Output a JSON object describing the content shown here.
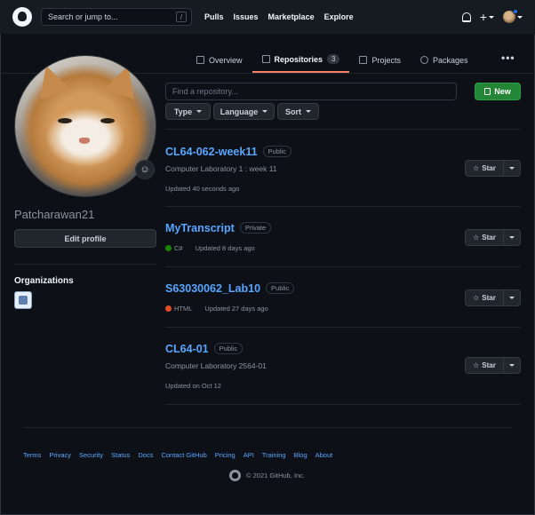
{
  "header": {
    "search_placeholder": "Search or jump to...",
    "search_key": "/",
    "nav": [
      "Pulls",
      "Issues",
      "Marketplace",
      "Explore"
    ],
    "plus": "+"
  },
  "tabs": [
    {
      "label": "Overview",
      "icon": "book-open-icon"
    },
    {
      "label": "Repositories",
      "icon": "repo-icon",
      "count": "3",
      "active": true
    },
    {
      "label": "Projects",
      "icon": "project-icon"
    },
    {
      "label": "Packages",
      "icon": "package-icon"
    }
  ],
  "more": "•••",
  "profile": {
    "username": "Patcharawan21",
    "edit_label": "Edit profile",
    "organizations_title": "Organizations",
    "emoji": "☺"
  },
  "filters": {
    "find_placeholder": "Find a repository...",
    "new_label": "New",
    "type_label": "Type",
    "language_label": "Language",
    "sort_label": "Sort"
  },
  "repos": [
    {
      "name": "CL64-062-week11",
      "visibility": "Public",
      "description": "Computer Laboratory 1 : week 11",
      "language": "",
      "updated": "Updated 40 seconds ago"
    },
    {
      "name": "MyTranscript",
      "visibility": "Private",
      "description": "",
      "language": "C#",
      "language_color": "#178600",
      "updated": "Updated 8 days ago"
    },
    {
      "name": "S63030062_Lab10",
      "visibility": "Public",
      "description": "",
      "language": "HTML",
      "language_color": "#e34c26",
      "updated": "Updated 27 days ago"
    },
    {
      "name": "CL64-01",
      "visibility": "Public",
      "description": "Computer Laboratory 2564-01",
      "language": "",
      "updated": "Updated on Oct 12"
    }
  ],
  "star_label": "Star",
  "footer": {
    "links": [
      "Terms",
      "Privacy",
      "Security",
      "Status",
      "Docs",
      "Contact GitHub",
      "Pricing",
      "API",
      "Training",
      "Blog",
      "About"
    ],
    "copyright": "© 2021 GitHub, Inc."
  },
  "colors": {
    "background": "#0d1117",
    "header": "#161b22",
    "link": "#58a6ff",
    "accent_tab": "#f78166",
    "new_button": "#238636",
    "notification_dot": "#1f6feb"
  }
}
